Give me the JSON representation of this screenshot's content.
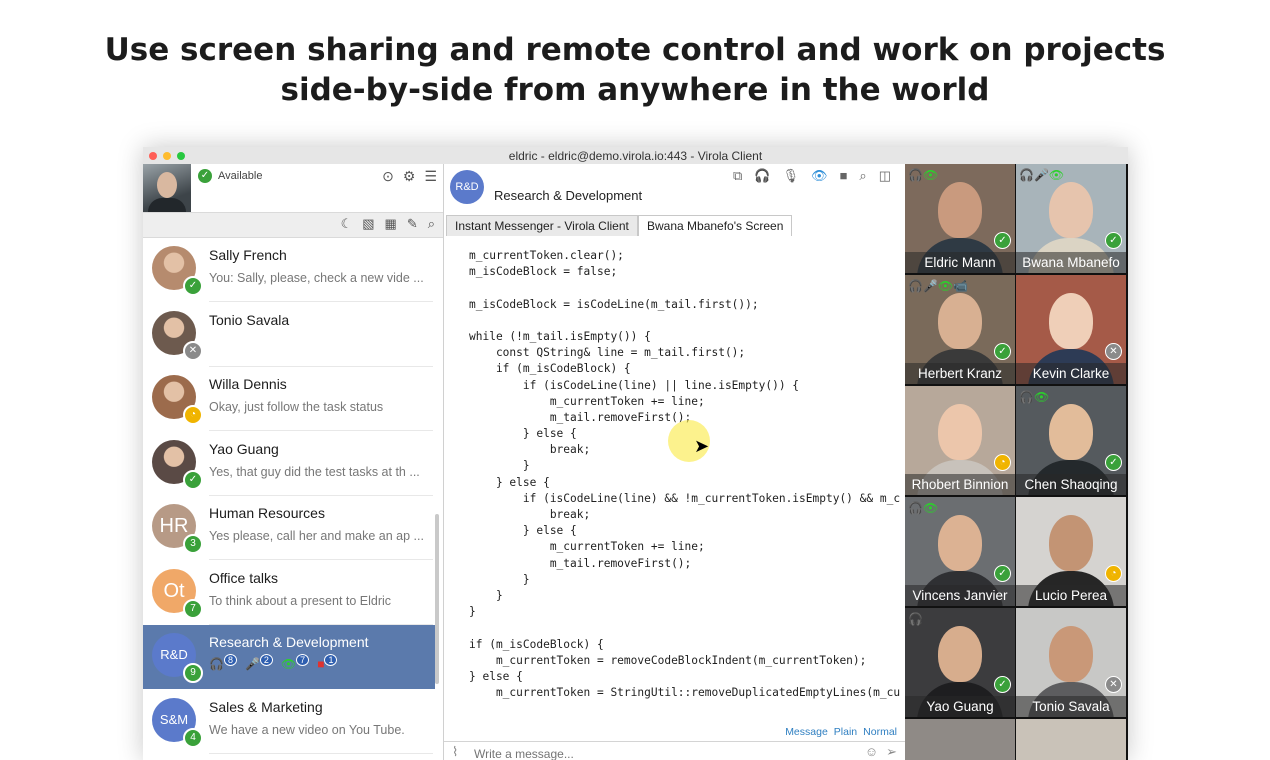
{
  "headline": {
    "line1": "Use screen sharing and remote control and work on projects",
    "line2": "side-by-side from anywhere in the world"
  },
  "window": {
    "title": "eldric - eldric@demo.virola.io:443 - Virola Client",
    "traffic_colors": [
      "#ff5f57",
      "#febc2e",
      "#28c840"
    ]
  },
  "me": {
    "status": "Available",
    "status_icon": "check-icon"
  },
  "left_icons": [
    "camera-icon",
    "gear-icon",
    "menu-icon"
  ],
  "toolbar_icons": [
    "moon-icon",
    "image-icon",
    "calendar-icon",
    "edit-icon",
    "search-icon"
  ],
  "contacts": [
    {
      "name": "Sally French",
      "msg": "You: Sally, please, check a new vide ...",
      "initials": "",
      "color": "#b68b6e",
      "badge": "✓",
      "badge_color": "#3aa13a"
    },
    {
      "name": "Tonio Savala",
      "msg": "",
      "initials": "",
      "color": "#6d5a4e",
      "badge": "✕",
      "badge_color": "#8a8a8a"
    },
    {
      "name": "Willa Dennis",
      "msg": "Okay, just follow the task status",
      "initials": "",
      "color": "#9c6b4c",
      "badge": "◔",
      "badge_color": "#f0b400"
    },
    {
      "name": "Yao Guang",
      "msg": "Yes, that guy did the test tasks at th ...",
      "initials": "",
      "color": "#5a4a45",
      "badge": "✓",
      "badge_color": "#3aa13a"
    },
    {
      "name": "Human Resources",
      "msg": "Yes please, call her and make an ap ...",
      "initials": "HR",
      "color": "#b79a86",
      "badge": "3",
      "badge_color": "#3aa13a"
    },
    {
      "name": "Office talks",
      "msg": "To think about a present to Eldric",
      "initials": "Ot",
      "color": "#f0a868",
      "badge": "7",
      "badge_color": "#3aa13a"
    },
    {
      "name": "Research & Development",
      "msg": "",
      "initials": "R&D",
      "color": "#5b7acb",
      "badge": "9",
      "badge_color": "#3aa13a",
      "presence": [
        "8",
        "2",
        "7",
        "1"
      ]
    },
    {
      "name": "Sales & Marketing",
      "msg": "We have a new video on You Tube.",
      "initials": "S&M",
      "color": "#5b7acb",
      "badge": "4",
      "badge_color": "#3aa13a"
    }
  ],
  "conversation": {
    "avatar": "R&D",
    "title": "Research & Development",
    "icons": [
      "screens-icon",
      "headphones-icon",
      "microphone-icon",
      "eye-icon",
      "video-camera-icon",
      "search-icon",
      "panel-icon"
    ],
    "tabs": [
      "Instant Messenger - Virola Client",
      "Bwana Mbanefo's Screen"
    ],
    "code": [
      "m_currentToken.clear();",
      "m_isCodeBlock = false;",
      "",
      "m_isCodeBlock = isCodeLine(m_tail.first());",
      "",
      "while (!m_tail.isEmpty()) {",
      "    const QString& line = m_tail.first();",
      "    if (m_isCodeBlock) {",
      "        if (isCodeLine(line) || line.isEmpty()) {",
      "            m_currentToken += line;",
      "            m_tail.removeFirst();",
      "        } else {",
      "            break;",
      "        }",
      "    } else {",
      "        if (isCodeLine(line) && !m_currentToken.isEmpty() && m_c",
      "            break;",
      "        } else {",
      "            m_currentToken += line;",
      "            m_tail.removeFirst();",
      "        }",
      "    }",
      "}",
      "",
      "if (m_isCodeBlock) {",
      "    m_currentToken = removeCodeBlockIndent(m_currentToken);",
      "} else {",
      "    m_currentToken = StringUtil::removeDuplicatedEmptyLines(m_cu"
    ],
    "formats": [
      "Message",
      "Plain",
      "Normal"
    ],
    "composer_placeholder": "Write a message..."
  },
  "participants": [
    {
      "name": "Eldric Mann",
      "skin": "#c99a7e",
      "bg": "#7d6a5c",
      "shirt": "#2f3a44",
      "status": "✓",
      "status_color": "#3aa13a",
      "icons": "🎧👁"
    },
    {
      "name": "Bwana Mbanefo",
      "skin": "#e6c4ad",
      "bg": "#a8b4ba",
      "shirt": "#dbd4c4",
      "status": "✓",
      "status_color": "#3aa13a",
      "icons": "🎧🎤👁"
    },
    {
      "name": "Herbert Kranz",
      "skin": "#d8b092",
      "bg": "#7a6a5a",
      "shirt": "#3a3a3a",
      "status": "✓",
      "status_color": "#3aa13a",
      "icons": "🎧🎤👁📹"
    },
    {
      "name": "Kevin Clarke",
      "skin": "#efcfb8",
      "bg": "#a55a48",
      "shirt": "#2d3b55",
      "status": "✕",
      "status_color": "#8a8a8a",
      "icons": ""
    },
    {
      "name": "Rhobert Binnion",
      "skin": "#ecc6ab",
      "bg": "#b7a89a",
      "shirt": "#c8c2bb",
      "status": "◔",
      "status_color": "#f0b400",
      "icons": ""
    },
    {
      "name": "Chen Shaoqing",
      "skin": "#e2bc9a",
      "bg": "#555a5e",
      "shirt": "#24292c",
      "status": "✓",
      "status_color": "#3aa13a",
      "icons": "🎧👁"
    },
    {
      "name": "Vincens Janvier",
      "skin": "#dcb293",
      "bg": "#6b6e71",
      "shirt": "#2f3033",
      "status": "✓",
      "status_color": "#3aa13a",
      "icons": "🎧👁"
    },
    {
      "name": "Lucio Perea",
      "skin": "#c39474",
      "bg": "#d5d3d0",
      "shirt": "#262626",
      "status": "◔",
      "status_color": "#f0b400",
      "icons": ""
    },
    {
      "name": "Yao Guang",
      "skin": "#d7ad8d",
      "bg": "#3c3c3e",
      "shirt": "#1e1e20",
      "status": "✓",
      "status_color": "#3aa13a",
      "icons": "🎧"
    },
    {
      "name": "Tonio Savala",
      "skin": "#c99878",
      "bg": "#c8c8c6",
      "shirt": "#5d5d5f",
      "status": "✕",
      "status_color": "#8a8a8a",
      "icons": ""
    }
  ]
}
